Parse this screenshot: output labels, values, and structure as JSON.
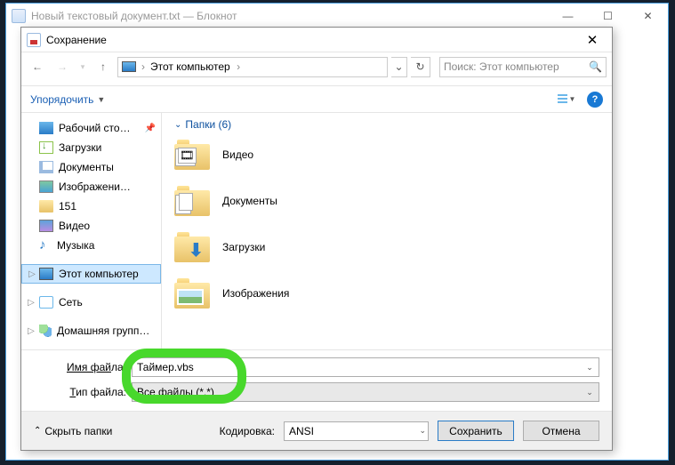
{
  "notepad": {
    "title": "Новый текстовый документ.txt — Блокнот"
  },
  "dialog": {
    "title": "Сохранение",
    "breadcrumb": {
      "root": "Этот компьютер"
    },
    "search_placeholder": "Поиск: Этот компьютер",
    "organize_label": "Упорядочить",
    "section_header": "Папки (6)",
    "tree": {
      "desktop": "Рабочий сто…",
      "downloads": "Загрузки",
      "documents": "Документы",
      "pictures": "Изображени…",
      "folder151": "151",
      "video": "Видео",
      "music": "Музыка",
      "thispc": "Этот компьютер",
      "network": "Сеть",
      "homegroup": "Домашняя групп…"
    },
    "folders": [
      {
        "label": "Видео"
      },
      {
        "label": "Документы"
      },
      {
        "label": "Загрузки"
      },
      {
        "label": "Изображения"
      }
    ],
    "form": {
      "filename_label_pre": "Имя фай",
      "filename_label_u": "л",
      "filename_label_post": "а:",
      "filename_value": "Таймер.vbs",
      "filetype_label_u": "Т",
      "filetype_label_post": "ип файла:",
      "filetype_value": "Все файлы  (*.*)"
    },
    "footer": {
      "hide_folders": "Скрыть папки",
      "encoding_label": "Кодировка:",
      "encoding_value": "ANSI",
      "save": "Сохранить",
      "cancel": "Отмена"
    }
  }
}
